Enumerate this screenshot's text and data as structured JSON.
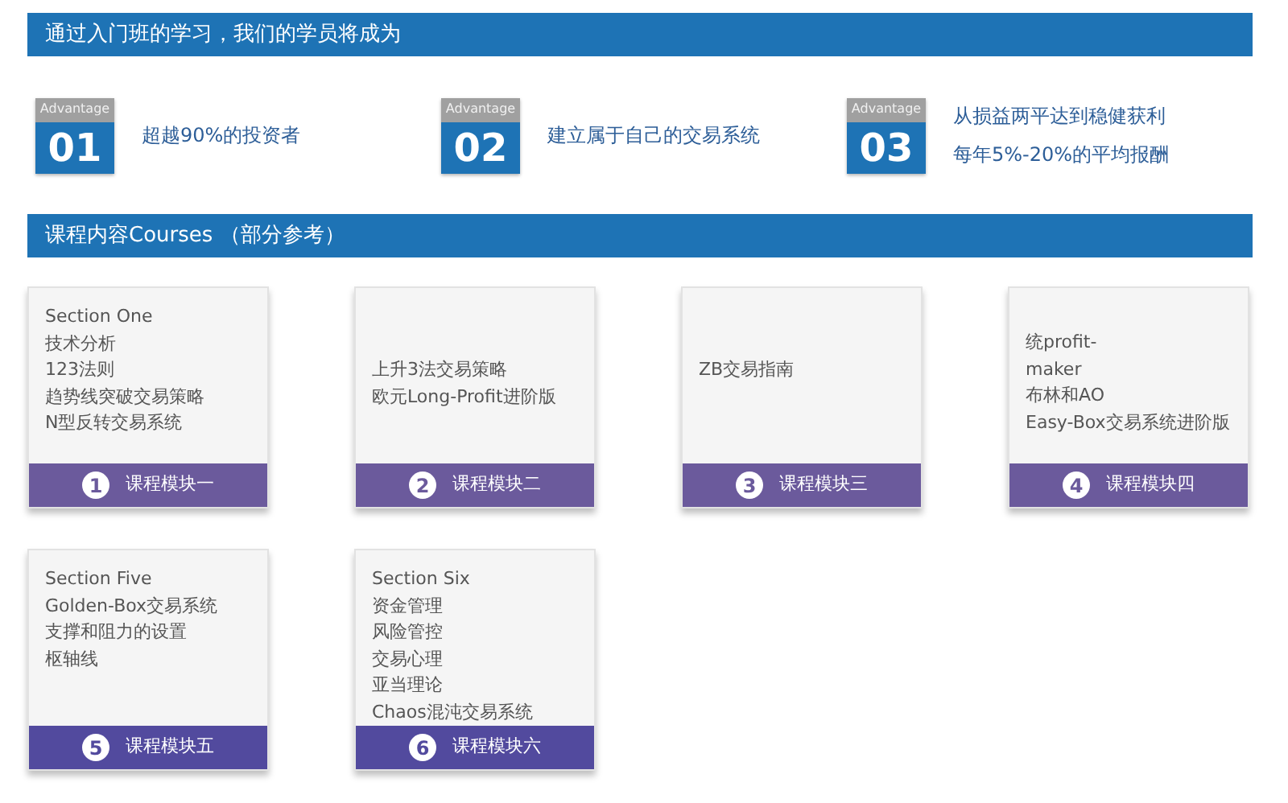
{
  "header": {
    "title": "通过入门班的学习，我们的学员将成为"
  },
  "advantages": [
    {
      "badge": "Advantage",
      "number": "01",
      "lines": [
        "超越90%的投资者"
      ]
    },
    {
      "badge": "Advantage",
      "number": "02",
      "lines": [
        "建立属于自己的交易系统"
      ]
    },
    {
      "badge": "Advantage",
      "number": "03",
      "lines": [
        "从损益两平达到稳健获利",
        "每年5%-20%的平均报酬"
      ]
    }
  ],
  "courses_header": {
    "title": "课程内容Courses （部分参考）"
  },
  "modules": [
    {
      "lines": [
        "Section One",
        "技术分析",
        "123法则",
        "趋势线突破交易策略",
        "N型反转交易系统"
      ],
      "index": "1",
      "label": "课程模块一",
      "color": "#6b5a9c"
    },
    {
      "lines": [
        "上升3法交易策略",
        "欧元Long-Profit进阶版"
      ],
      "index": "2",
      "label": "课程模块二",
      "color": "#6b5a9c"
    },
    {
      "lines": [
        "ZB交易指南"
      ],
      "index": "3",
      "label": "课程模块三",
      "color": "#6b5a9c"
    },
    {
      "lines": [
        "统profit-",
        "maker",
        "布林和AO",
        "Easy-Box交易系统进阶版"
      ],
      "index": "4",
      "label": "课程模块四",
      "color": "#6b5a9c"
    },
    {
      "lines": [
        "Section Five",
        "Golden-Box交易系统",
        "支撑和阻力的设置",
        "枢轴线"
      ],
      "index": "5",
      "label": "课程模块五",
      "color": "#524a9e"
    },
    {
      "lines": [
        "Section Six",
        "资金管理",
        "风险管控",
        "交易心理",
        "亚当理论",
        "Chaos混沌交易系统"
      ],
      "index": "6",
      "label": "课程模块六",
      "color": "#524a9e"
    }
  ]
}
